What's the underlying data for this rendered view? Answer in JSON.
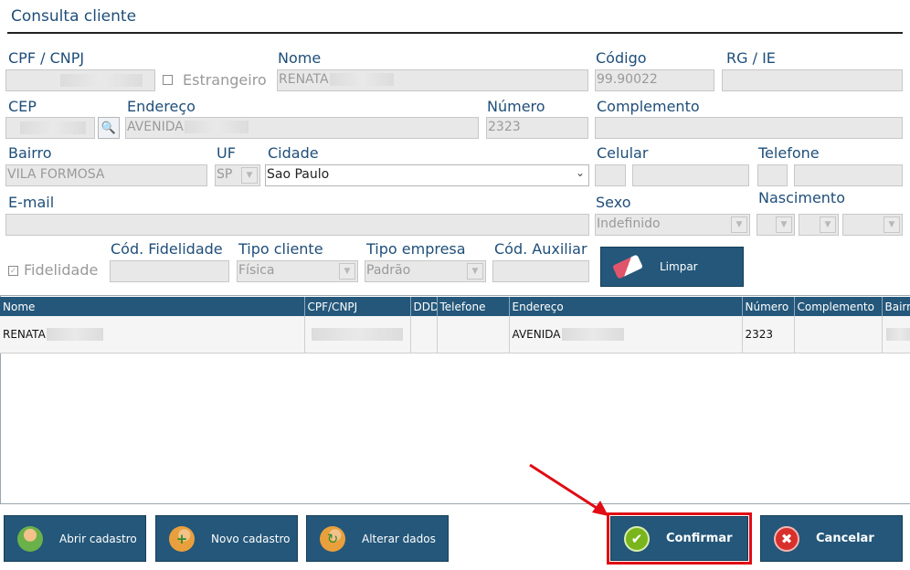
{
  "window": {
    "title": "Consulta cliente"
  },
  "form": {
    "cpf_cnpj": {
      "label": "CPF / CNPJ"
    },
    "estrangeiro": {
      "label": "Estrangeiro"
    },
    "nome": {
      "label": "Nome",
      "value": "RENATA"
    },
    "codigo": {
      "label": "Código",
      "value": "99.90022"
    },
    "rg_ie": {
      "label": "RG / IE"
    },
    "cep": {
      "label": "CEP"
    },
    "endereco": {
      "label": "Endereço",
      "value": "AVENIDA"
    },
    "numero": {
      "label": "Número",
      "value": "2323"
    },
    "complemento": {
      "label": "Complemento"
    },
    "bairro": {
      "label": "Bairro",
      "value": "VILA FORMOSA"
    },
    "uf": {
      "label": "UF",
      "value": "SP"
    },
    "cidade": {
      "label": "Cidade",
      "value": "Sao Paulo"
    },
    "celular": {
      "label": "Celular"
    },
    "telefone": {
      "label": "Telefone"
    },
    "email": {
      "label": "E-mail"
    },
    "sexo": {
      "label": "Sexo",
      "value": "Indefinido"
    },
    "nascimento": {
      "label": "Nascimento"
    },
    "fidelidade": {
      "label": "Fidelidade",
      "checked": true
    },
    "cod_fidelidade": {
      "label": "Cód. Fidelidade"
    },
    "tipo_cliente": {
      "label": "Tipo cliente",
      "value": "Física"
    },
    "tipo_empresa": {
      "label": "Tipo empresa",
      "value": "Padrão"
    },
    "cod_auxiliar": {
      "label": "Cód. Auxiliar"
    }
  },
  "buttons": {
    "limpar": "Limpar",
    "abrir_cadastro": "Abrir cadastro",
    "novo_cadastro": "Novo cadastro",
    "alterar_dados": "Alterar dados",
    "confirmar": "Confirmar",
    "cancelar": "Cancelar"
  },
  "icons": {
    "search": "magnifier-icon",
    "limpar": "eraser-icon",
    "abrir_cadastro": "user-icon",
    "novo_cadastro": "user-add-icon",
    "alterar_dados": "user-edit-icon",
    "confirmar": "check-icon",
    "cancelar": "close-icon"
  },
  "grid": {
    "columns": [
      "Nome",
      "CPF/CNPJ",
      "DDD",
      "Telefone",
      "Endereço",
      "Número",
      "Complemento",
      "Bairro"
    ],
    "rows": [
      {
        "nome": "RENATA",
        "cpf_cnpj": "",
        "ddd": "",
        "telefone": "",
        "endereco": "AVENIDA",
        "numero": "2323",
        "complemento": "",
        "bairro": ""
      }
    ]
  },
  "colors": {
    "accent": "#24577a",
    "label": "#1f4e79",
    "highlight": "#e10c14",
    "confirm_icon": "#7ab51d",
    "cancel_icon": "#d8302b"
  }
}
